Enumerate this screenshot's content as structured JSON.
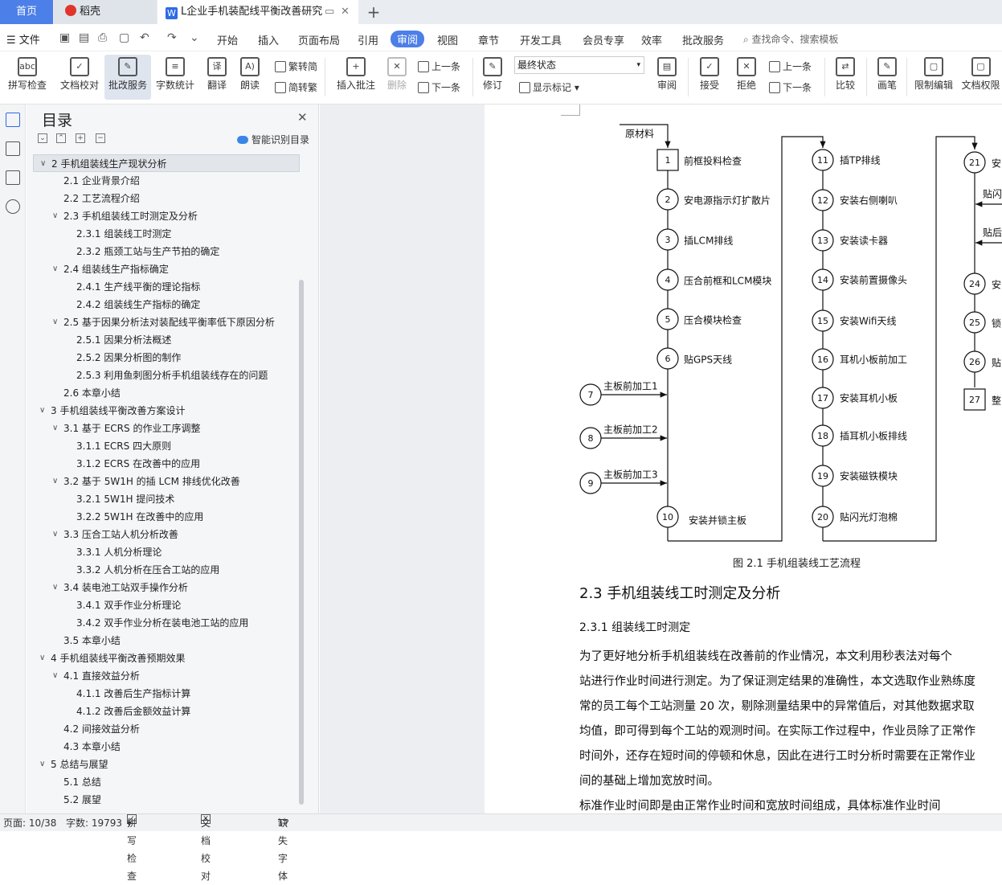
{
  "tabs": {
    "home": "首页",
    "app": "稻壳",
    "doc": "L企业手机装配线平衡改善研究"
  },
  "menu": {
    "file": "文件",
    "items": [
      "开始",
      "插入",
      "页面布局",
      "引用",
      "审阅",
      "视图",
      "章节",
      "开发工具",
      "会员专享",
      "效率",
      "批改服务"
    ],
    "active": "审阅",
    "search": "查找命令、搜索模板"
  },
  "ribbon": {
    "spell": "拼写检查",
    "proof": "文档校对",
    "review_service": "批改服务",
    "wordcount": "字数统计",
    "translate": "翻译",
    "read": "朗读",
    "trad": "繁转简",
    "simp": "简转繁",
    "insert_comment": "插入批注",
    "delete": "删除",
    "prev": "上一条",
    "next": "下一条",
    "revise": "修订",
    "final_state": "最终状态",
    "show_marks": "显示标记",
    "review": "审阅",
    "accept": "接受",
    "reject": "拒绝",
    "prev2": "上一条",
    "next2": "下一条",
    "compare": "比较",
    "pen": "画笔",
    "restrict": "限制编辑",
    "permission": "文档权限"
  },
  "toc": {
    "title": "目录",
    "smart": "智能识别目录",
    "items": [
      {
        "text": "2  手机组装线生产现状分析",
        "level": 1,
        "sel": true
      },
      {
        "text": "2.1  企业背景介绍",
        "level": 2
      },
      {
        "text": "2.2  工艺流程介绍",
        "level": 2
      },
      {
        "text": "2.3 手机组装线工时测定及分析",
        "level": 2,
        "arrow": true
      },
      {
        "text": "2.3.1  组装线工时测定",
        "level": 3
      },
      {
        "text": "2.3.2  瓶颈工站与生产节拍的确定",
        "level": 3
      },
      {
        "text": "2.4  组装线生产指标确定",
        "level": 2,
        "arrow": true
      },
      {
        "text": "2.4.1  生产线平衡的理论指标",
        "level": 3
      },
      {
        "text": "2.4.2  组装线生产指标的确定",
        "level": 3
      },
      {
        "text": "2.5  基于因果分析法对装配线平衡率低下原因分析",
        "level": 2,
        "arrow": true
      },
      {
        "text": "2.5.1  因果分析法概述",
        "level": 3
      },
      {
        "text": "2.5.2 因果分析图的制作",
        "level": 3
      },
      {
        "text": "2.5.3  利用鱼刺图分析手机组装线存在的问题",
        "level": 3
      },
      {
        "text": "2.6  本章小结",
        "level": 2
      },
      {
        "text": "3  手机组装线平衡改善方案设计",
        "level": 1,
        "arrow": true
      },
      {
        "text": "3.1  基于 ECRS 的作业工序调整",
        "level": 2,
        "arrow": true
      },
      {
        "text": "3.1.1 ECRS 四大原则",
        "level": 3
      },
      {
        "text": "3.1.2 ECRS 在改善中的应用",
        "level": 3
      },
      {
        "text": "3.2  基于 5W1H 的插 LCM 排线优化改善",
        "level": 2,
        "arrow": true
      },
      {
        "text": "3.2.1 5W1H 提问技术",
        "level": 3
      },
      {
        "text": "3.2.2 5W1H 在改善中的应用",
        "level": 3
      },
      {
        "text": "3.3  压合工站人机分析改善",
        "level": 2,
        "arrow": true
      },
      {
        "text": "3.3.1  人机分析理论",
        "level": 3
      },
      {
        "text": "3.3.2  人机分析在压合工站的应用",
        "level": 3
      },
      {
        "text": "3.4  装电池工站双手操作分析",
        "level": 2,
        "arrow": true
      },
      {
        "text": "3.4.1  双手作业分析理论",
        "level": 3
      },
      {
        "text": "3.4.2  双手作业分析在装电池工站的应用",
        "level": 3
      },
      {
        "text": "3.5  本章小结",
        "level": 2
      },
      {
        "text": "4  手机组装线平衡改善预期效果",
        "level": 1,
        "arrow": true
      },
      {
        "text": "4.1  直接效益分析",
        "level": 2,
        "arrow": true
      },
      {
        "text": "4.1.1  改善后生产指标计算",
        "level": 3
      },
      {
        "text": "4.1.2  改善后金额效益计算",
        "level": 3
      },
      {
        "text": "4.2  间接效益分析",
        "level": 2
      },
      {
        "text": "4.3  本章小结",
        "level": 2
      },
      {
        "text": "5  总结与展望",
        "level": 1,
        "arrow": true
      },
      {
        "text": "5.1 总结",
        "level": 2
      },
      {
        "text": "5.2  展望",
        "level": 2
      }
    ]
  },
  "flow": {
    "input": "原材料",
    "col1": [
      {
        "n": "1",
        "t": "前框投料检查"
      },
      {
        "n": "2",
        "t": "安电源指示灯扩散片"
      },
      {
        "n": "3",
        "t": "插LCM排线"
      },
      {
        "n": "4",
        "t": "压合前框和LCM模块"
      },
      {
        "n": "5",
        "t": "压合模块检查"
      },
      {
        "n": "6",
        "t": "贴GPS天线"
      },
      {
        "n": "10",
        "t": "安装并锁主板"
      }
    ],
    "side": [
      {
        "n": "7",
        "t": "主板前加工1"
      },
      {
        "n": "8",
        "t": "主板前加工2"
      },
      {
        "n": "9",
        "t": "主板前加工3"
      }
    ],
    "col2": [
      {
        "n": "11",
        "t": "插TP排线"
      },
      {
        "n": "12",
        "t": "安装右侧喇叭"
      },
      {
        "n": "13",
        "t": "安装读卡器"
      },
      {
        "n": "14",
        "t": "安装前置摄像头"
      },
      {
        "n": "15",
        "t": "安装Wifi天线"
      },
      {
        "n": "16",
        "t": "耳机小板前加工"
      },
      {
        "n": "17",
        "t": "安装耳机小板"
      },
      {
        "n": "18",
        "t": "插耳机小板排线"
      },
      {
        "n": "19",
        "t": "安装磁铁模块"
      },
      {
        "n": "20",
        "t": "贴闪光灯泡棉"
      }
    ],
    "col3": [
      {
        "n": "21",
        "t": "安"
      },
      {
        "n": "24",
        "t": "安"
      },
      {
        "n": "25",
        "t": "锁"
      },
      {
        "n": "26",
        "t": "贴"
      },
      {
        "n": "27",
        "t": "整"
      }
    ],
    "col3_side": [
      "贴闪",
      "贴后"
    ]
  },
  "doc": {
    "caption": "图 2.1  手机组装线工艺流程",
    "h2": "2.3 手机组装线工时测定及分析",
    "h3": "2.3.1  组装线工时测定",
    "lines": [
      "    为了更好地分析手机组装线在改善前的作业情况，本文利用秒表法对每个",
      "站进行作业时间进行测定。为了保证测定结果的准确性，本文选取作业熟练度",
      "常的员工每个工站测量 20 次，剔除测量结果中的异常值后，对其他数据求取",
      "均值，即可得到每个工站的观测时间。在实际工作过程中，作业员除了正常作",
      "时间外，还存在短时间的停顿和休息，因此在进行工时分析时需要在正常作业",
      "间的基础上增加宽放时间。",
      "    标准作业时间即是由正常作业时间和宽放时间组成，具体标准作业时间"
    ]
  },
  "status": {
    "page": "页面: 10/38",
    "words": "字数: 19793",
    "spell": "拼写检查",
    "proof": "文档校对",
    "font": "缺失字体"
  }
}
